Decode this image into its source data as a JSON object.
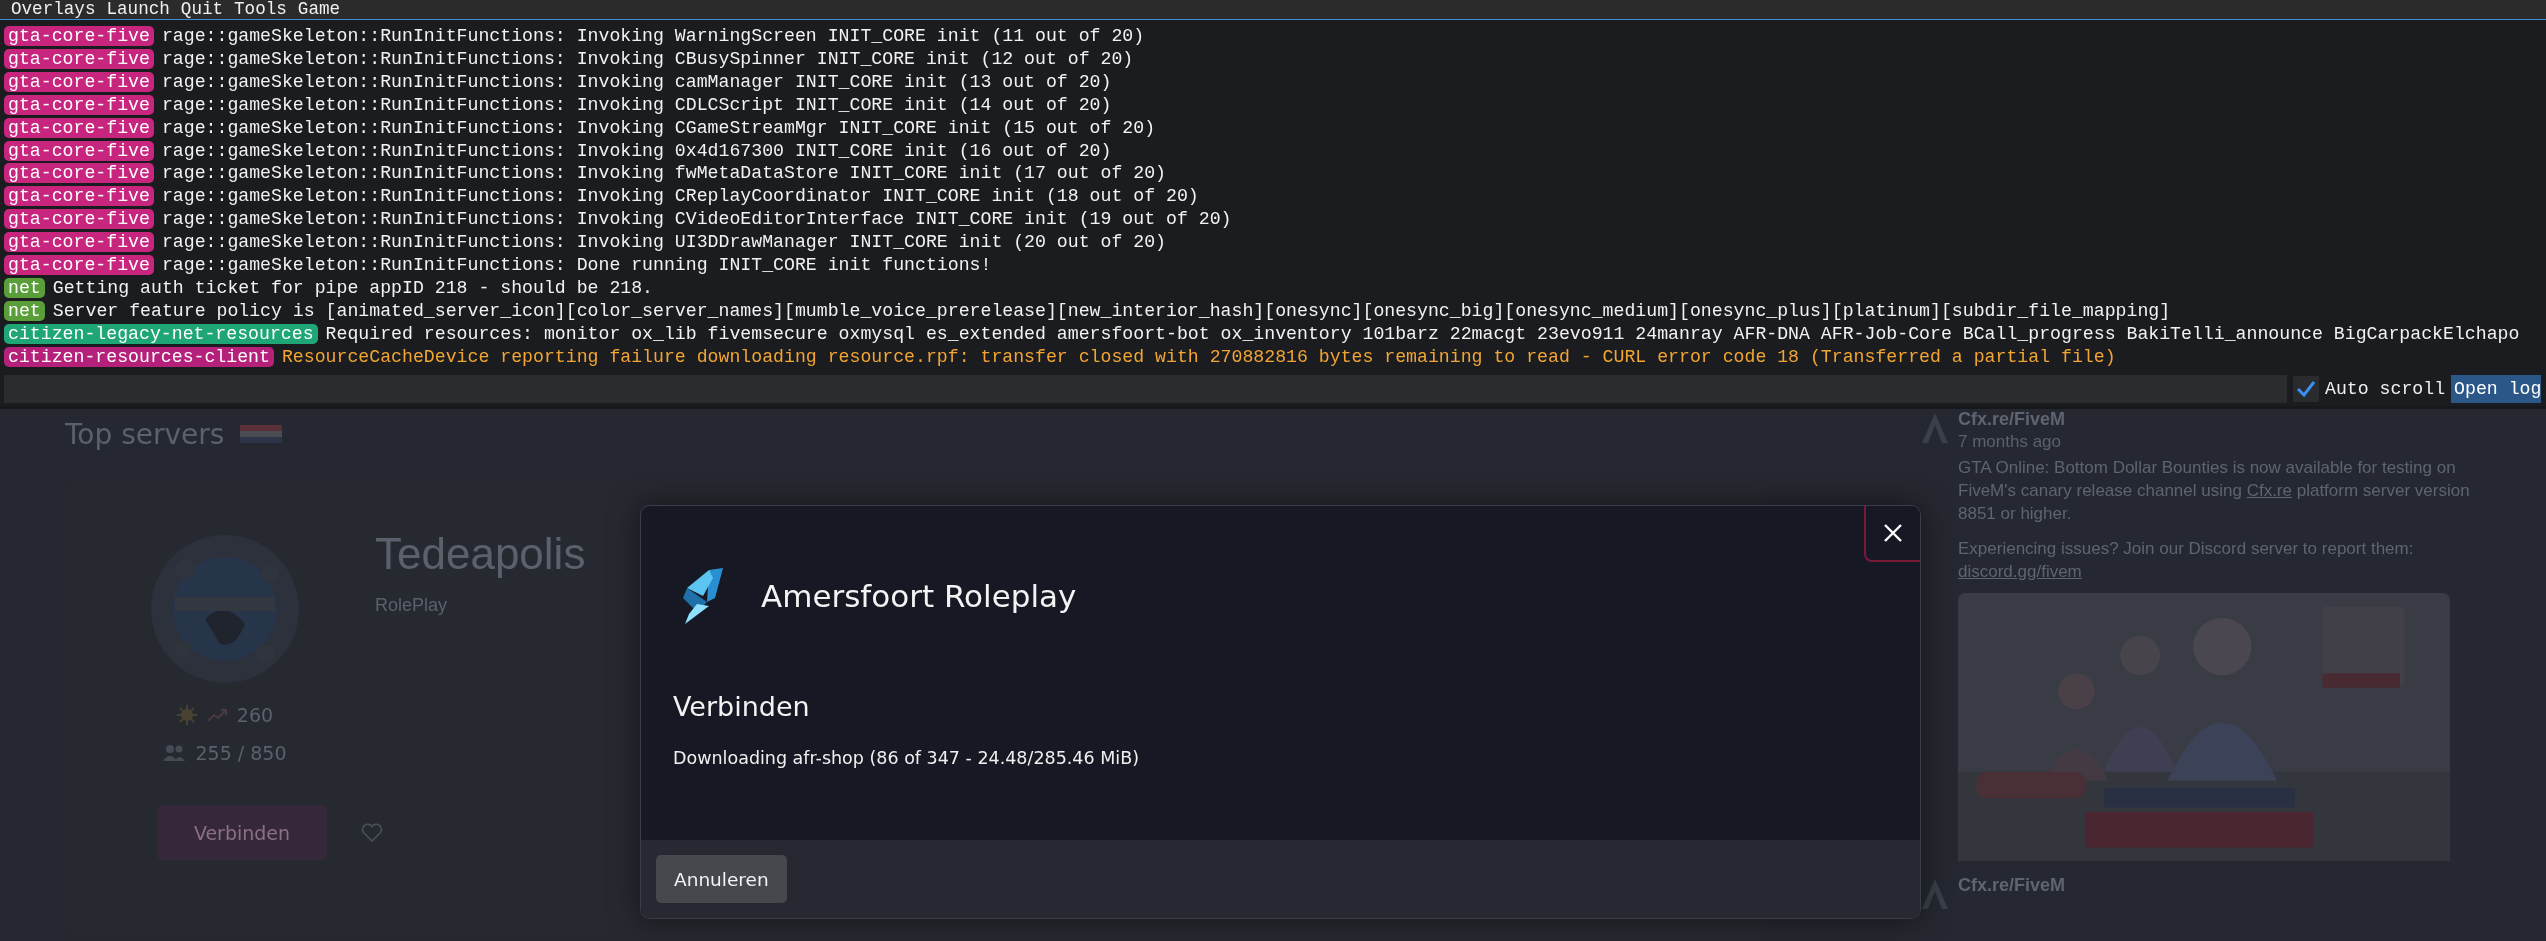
{
  "menu": [
    "Overlays",
    "Launch",
    "Quit",
    "Tools",
    "Game"
  ],
  "console": {
    "lines": [
      {
        "tag": "gta-core-five",
        "color": "#c8267e",
        "kind": "info",
        "text": "rage::gameSkeleton::RunInitFunctions: Invoking WarningScreen INIT_CORE init (11 out of 20)"
      },
      {
        "tag": "gta-core-five",
        "color": "#c8267e",
        "kind": "info",
        "text": "rage::gameSkeleton::RunInitFunctions: Invoking CBusySpinner INIT_CORE init (12 out of 20)"
      },
      {
        "tag": "gta-core-five",
        "color": "#c8267e",
        "kind": "info",
        "text": "rage::gameSkeleton::RunInitFunctions: Invoking camManager INIT_CORE init (13 out of 20)"
      },
      {
        "tag": "gta-core-five",
        "color": "#c8267e",
        "kind": "info",
        "text": "rage::gameSkeleton::RunInitFunctions: Invoking CDLCScript INIT_CORE init (14 out of 20)"
      },
      {
        "tag": "gta-core-five",
        "color": "#c8267e",
        "kind": "info",
        "text": "rage::gameSkeleton::RunInitFunctions: Invoking CGameStreamMgr INIT_CORE init (15 out of 20)"
      },
      {
        "tag": "gta-core-five",
        "color": "#c8267e",
        "kind": "info",
        "text": "rage::gameSkeleton::RunInitFunctions: Invoking 0x4d167300 INIT_CORE init (16 out of 20)"
      },
      {
        "tag": "gta-core-five",
        "color": "#c8267e",
        "kind": "info",
        "text": "rage::gameSkeleton::RunInitFunctions: Invoking fwMetaDataStore INIT_CORE init (17 out of 20)"
      },
      {
        "tag": "gta-core-five",
        "color": "#c8267e",
        "kind": "info",
        "text": "rage::gameSkeleton::RunInitFunctions: Invoking CReplayCoordinator INIT_CORE init (18 out of 20)"
      },
      {
        "tag": "gta-core-five",
        "color": "#c8267e",
        "kind": "info",
        "text": "rage::gameSkeleton::RunInitFunctions: Invoking CVideoEditorInterface INIT_CORE init (19 out of 20)"
      },
      {
        "tag": "gta-core-five",
        "color": "#c8267e",
        "kind": "info",
        "text": "rage::gameSkeleton::RunInitFunctions: Invoking UI3DDrawManager INIT_CORE init (20 out of 20)"
      },
      {
        "tag": "gta-core-five",
        "color": "#c8267e",
        "kind": "info",
        "text": "rage::gameSkeleton::RunInitFunctions: Done running INIT_CORE init functions!"
      },
      {
        "tag": "net",
        "color": "#5a9e3a",
        "kind": "info",
        "text": "Getting auth ticket for pipe appID 218 - should be 218."
      },
      {
        "tag": "net",
        "color": "#5a9e3a",
        "kind": "info",
        "text": "Server feature policy is [animated_server_icon][color_server_names][mumble_voice_prerelease][new_interior_hash][onesync][onesync_big][onesync_medium][onesync_plus][platinum][subdir_file_mapping]"
      },
      {
        "tag": "citizen-legacy-net-resources",
        "color": "#1ea676",
        "kind": "info",
        "text": "Required resources: monitor ox_lib fivemsecure oxmysql es_extended amersfoort-bot ox_inventory 101barz 22macgt 23evo911 24manray AFR-DNA AFR-Job-Core BCall_progress BakiTelli_announce BigCarpackElchapo"
      },
      {
        "tag": "citizen-resources-client",
        "color": "#b5207a",
        "kind": "error",
        "text": "ResourceCacheDevice reporting failure downloading resource.rpf: transfer closed with 270882816 bytes remaining to read - CURL error code 18 (Transferred a partial file)"
      }
    ],
    "auto_scroll": {
      "label": "Auto scroll",
      "checked": true
    },
    "open_log": "Open log"
  },
  "background": {
    "section_title": "Top servers",
    "featured": {
      "name": "Tedeapolis",
      "tag": "RolePlay",
      "boosts": "260",
      "players": "255 / 850",
      "connect": "Verbinden"
    },
    "news": [
      {
        "author": "Cfx.re/FiveM",
        "time": "7 months ago",
        "paragraphs": [
          {
            "text": "GTA Online: Bottom Dollar Bounties is now available for testing on FiveM's canary release channel using ",
            "link": "Cfx.re",
            "after": " platform server version 8851 or higher."
          },
          {
            "text": "Experiencing issues? Join our Discord server to report them: ",
            "link": "discord.gg/fivem"
          }
        ]
      },
      {
        "author": "Cfx.re/FiveM"
      }
    ]
  },
  "modal": {
    "server_name": "Amersfoort Roleplay",
    "title": "Verbinden",
    "status": "Downloading afr-shop (86 of 347 - 24.48/285.46 MiB)",
    "cancel": "Annuleren"
  }
}
